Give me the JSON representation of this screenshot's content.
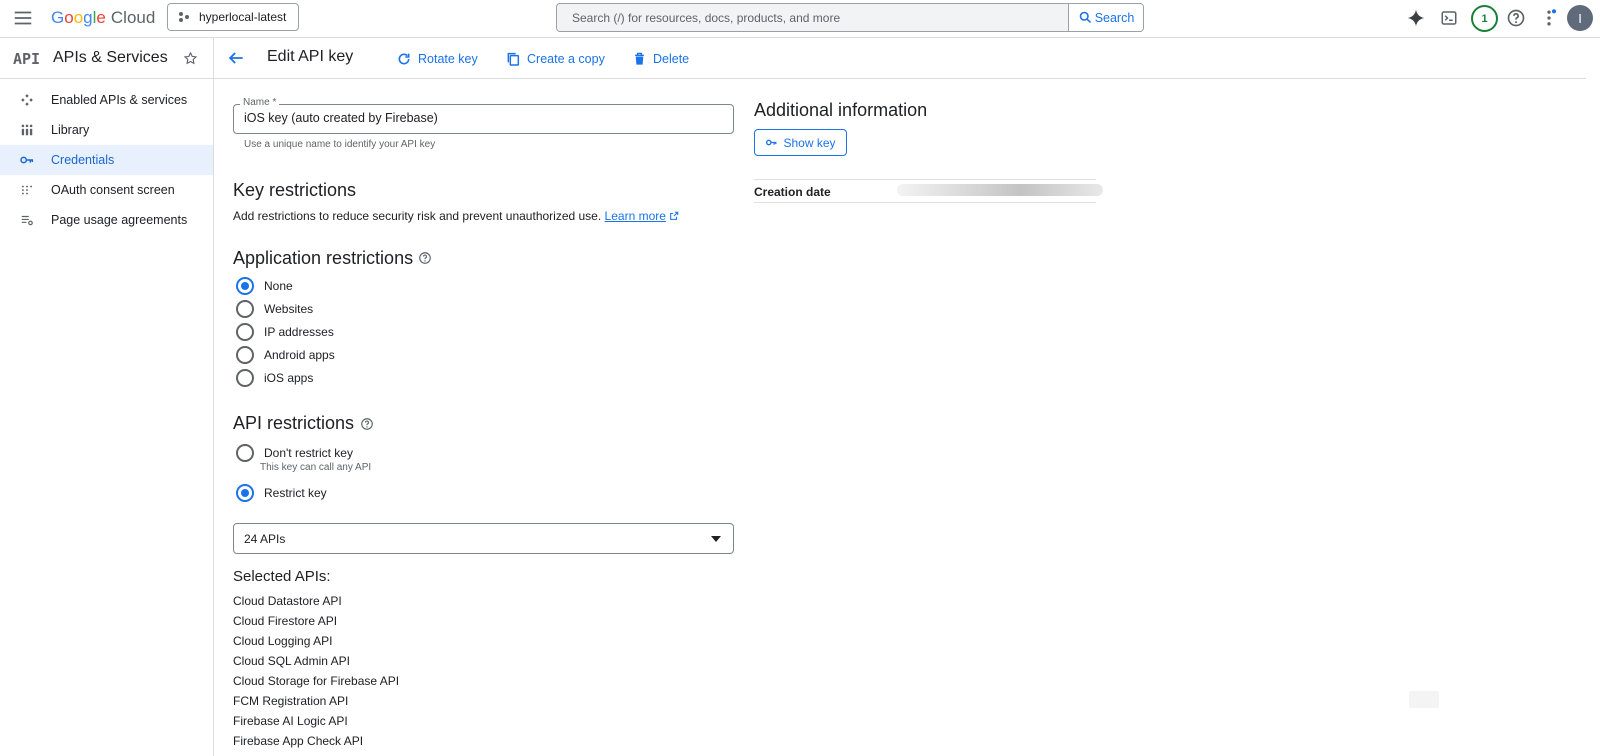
{
  "topbar": {
    "logo_letters": [
      "G",
      "o",
      "o",
      "g",
      "l",
      "e"
    ],
    "logo_suffix": "Cloud",
    "project": "hyperlocal-latest",
    "search_placeholder": "Search (/) for resources, docs, products, and more",
    "search_button": "Search",
    "notification_count": "1",
    "avatar_initial": "I"
  },
  "sidebar": {
    "logo": "API",
    "title": "APIs & Services",
    "items": [
      {
        "label": "Enabled APIs & services",
        "icon": "enabled-apis-icon"
      },
      {
        "label": "Library",
        "icon": "library-icon"
      },
      {
        "label": "Credentials",
        "icon": "key-icon",
        "active": true
      },
      {
        "label": "OAuth consent screen",
        "icon": "oauth-icon"
      },
      {
        "label": "Page usage agreements",
        "icon": "settings-list-icon"
      }
    ]
  },
  "header": {
    "title": "Edit API key",
    "rotate": "Rotate key",
    "copy": "Create a copy",
    "delete": "Delete"
  },
  "name_field": {
    "label": "Name *",
    "value": "iOS key (auto created by Firebase)",
    "hint": "Use a unique name to identify your API key"
  },
  "key_restrictions": {
    "title": "Key restrictions",
    "description": "Add restrictions to reduce security risk and prevent unauthorized use.",
    "learn_more": "Learn more"
  },
  "application_restrictions": {
    "title": "Application restrictions",
    "options": [
      "None",
      "Websites",
      "IP addresses",
      "Android apps",
      "iOS apps"
    ],
    "selected": "None"
  },
  "api_restrictions": {
    "title": "API restrictions",
    "options": [
      "Don't restrict key",
      "Restrict key"
    ],
    "dont_restrict_sub": "This key can call any API",
    "selected": "Restrict key",
    "select_value": "24 APIs"
  },
  "selected_apis": {
    "title": "Selected APIs:",
    "items": [
      "Cloud Datastore API",
      "Cloud Firestore API",
      "Cloud Logging API",
      "Cloud SQL Admin API",
      "Cloud Storage for Firebase API",
      "FCM Registration API",
      "Firebase AI Logic API",
      "Firebase App Check API"
    ]
  },
  "additional_info": {
    "title": "Additional information",
    "show_key": "Show key",
    "creation_date_label": "Creation date"
  },
  "colors": {
    "accent": "#1a73e8",
    "active_bg": "#e8f0fe",
    "text": "#202124",
    "muted": "#5f6368",
    "border": "#dadce0"
  }
}
